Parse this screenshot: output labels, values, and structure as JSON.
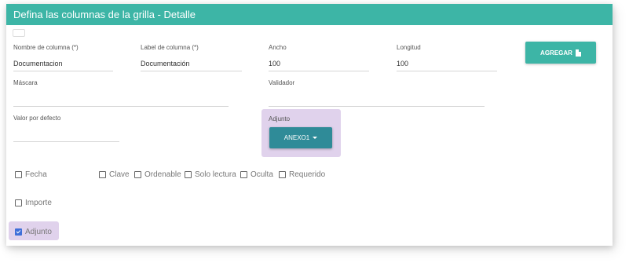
{
  "header": {
    "title": "Defina las columnas de la grilla - Detalle"
  },
  "fields": {
    "nombre": {
      "label": "Nombre de columna (*)",
      "value": "Documentacion"
    },
    "label_col": {
      "label": "Label de columna (*)",
      "value": "Documentación"
    },
    "ancho": {
      "label": "Ancho",
      "value": "100"
    },
    "longitud": {
      "label": "Longitud",
      "value": "100"
    },
    "mascara": {
      "label": "Máscara",
      "value": ""
    },
    "validador": {
      "label": "Validador",
      "value": ""
    },
    "valor_defecto": {
      "label": "Valor por defecto",
      "value": ""
    }
  },
  "buttons": {
    "agregar": "AGREGAR"
  },
  "adjunto": {
    "label": "Adjunto",
    "selected": "ANEXO1"
  },
  "checkboxes": {
    "fecha": {
      "label": "Fecha",
      "checked": false
    },
    "clave": {
      "label": "Clave",
      "checked": false
    },
    "ordenable": {
      "label": "Ordenable",
      "checked": false
    },
    "solo_lectura": {
      "label": "Solo lectura",
      "checked": false
    },
    "oculta": {
      "label": "Oculta",
      "checked": false
    },
    "requerido": {
      "label": "Requerido",
      "checked": false
    },
    "importe": {
      "label": "Importe",
      "checked": false
    },
    "adjunto": {
      "label": "Adjunto",
      "checked": true
    }
  },
  "colors": {
    "header": "#3db5a6",
    "dropdown": "#2f8b98",
    "highlight": "#e0d2ec",
    "checkbox_checked": "#3f6fd8"
  }
}
